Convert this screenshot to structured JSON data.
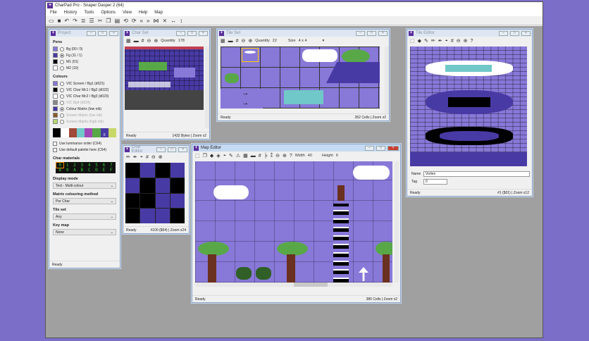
{
  "app": {
    "title": "CharPad Pro - Snaper Dasper 2 (64)",
    "menu": [
      "File",
      "History",
      "Tools",
      "Options",
      "View",
      "Help",
      "Map"
    ]
  },
  "toolbar": [
    "new",
    "save",
    "undo",
    "redo",
    "align",
    "stack",
    "cut",
    "copy",
    "paste",
    "rotate-left",
    "rotate-right",
    "shift-left",
    "shift-right",
    "flip-h",
    "flip-v",
    "swap-h",
    "swap-v"
  ],
  "project": {
    "title": "Project",
    "pens_label": "Pens",
    "pens": [
      {
        "label": "Bg (00 / 0)",
        "color": "#8878d8",
        "on": false
      },
      {
        "label": "Fg (11 / 1)",
        "color": "#483aa4",
        "on": true
      },
      {
        "label": "M1 (01)",
        "color": "#000000",
        "on": false
      },
      {
        "label": "M2 (10)",
        "color": "#ffffff",
        "on": false
      }
    ],
    "colours_label": "Colours",
    "colours": [
      {
        "label": "VIC Screen / Bg1 (d021)",
        "color": "#8878d8",
        "on": false,
        "dis": false
      },
      {
        "label": "VIC Char Mc1 / Bg2 (d022)",
        "color": "#000000",
        "on": false,
        "dis": false
      },
      {
        "label": "VIC Char Mc2 / Bg3 (d023)",
        "color": "#ffffff",
        "on": false,
        "dis": false
      },
      {
        "label": "VIC Bg4 (d024)",
        "color": "#888888",
        "on": false,
        "dis": true
      },
      {
        "label": "Colour Matrix (low nib)",
        "color": "#483aa4",
        "on": true,
        "dis": false
      },
      {
        "label": "Screen Matrix (low nib)",
        "color": "#8b5a2b",
        "on": false,
        "dis": true
      },
      {
        "label": "Screen Matrix (high nib)",
        "color": "#b8d870",
        "on": false,
        "dis": true
      }
    ],
    "palette": [
      "#000000",
      "#ffffff",
      "#a04a3a",
      "#70c8c8",
      "#a048b8",
      "#58a848",
      "#483aa4",
      "#c8d868"
    ],
    "palette_selected_label": "0",
    "checks": [
      "Use luminance order (C64)",
      "Use default palette here (C64)"
    ],
    "char_materials_label": "Char materials",
    "char_materials": [
      "0",
      "1",
      "2",
      "3",
      "4",
      "5",
      "6",
      "7",
      "8",
      "9",
      "A",
      "B",
      "C",
      "D",
      "E",
      "F"
    ],
    "display_mode_label": "Display mode",
    "display_mode": "Text - Multi-colour",
    "matrix_label": "Matrix colouring method",
    "matrix": "Per Char",
    "tileset_label": "Tile set",
    "tileset": "Any",
    "keymap_label": "Key map",
    "keymap": "None",
    "status": "Ready"
  },
  "charset": {
    "title": "Char Set",
    "quantity_label": "Quantity",
    "quantity": "178",
    "status": "Ready",
    "info": "1432 Bytes | Zoom x2"
  },
  "tileset": {
    "title": "Tile Set",
    "quantity_label": "Quantity",
    "quantity": "22",
    "size_label": "Size",
    "size": "4 x 4",
    "status": "Ready",
    "info": "352 Cells | Zoom x2"
  },
  "tileeditor": {
    "title": "Tile Editor",
    "name_label": "Name",
    "name": "Vortex",
    "tag_label": "Tag",
    "tag": "0",
    "status": "Ready",
    "info": "#1 ($01) | Zoom x12"
  },
  "chareditor": {
    "title": "Char Editor",
    "status": "Ready",
    "info": "#100 ($64) | Zoom x24"
  },
  "mapeditor": {
    "title": "Map Editor",
    "width_label": "Width",
    "width": "40",
    "height_label": "Height",
    "height": "6",
    "status": "Ready",
    "info": "380 Cells | Zoom x2"
  },
  "colors": {
    "c64bg": "#8878d8",
    "c64dark": "#483aa4"
  }
}
